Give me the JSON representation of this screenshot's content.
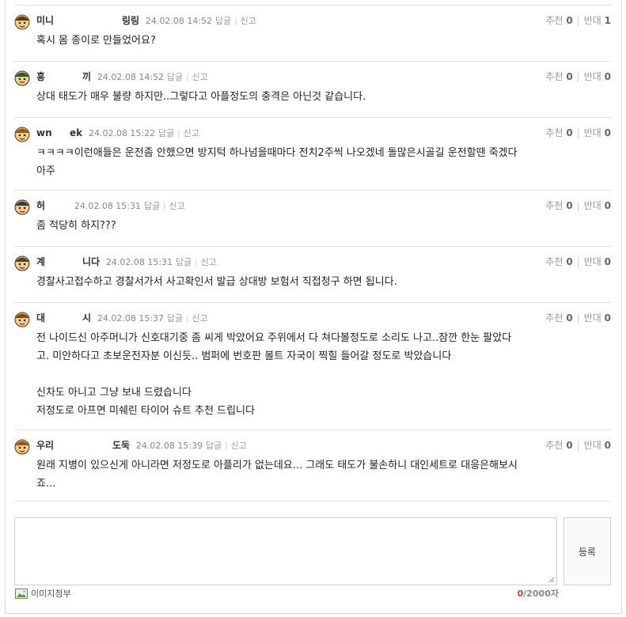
{
  "comments": [
    {
      "nick": "미니",
      "nick2": "링링",
      "date": "24.02.08 14:52",
      "reply": "답글",
      "report": "신고",
      "rec_label": "추천",
      "rec": "0",
      "opp_label": "반대",
      "opp": "1",
      "body": "혹시 몸 종이로 만들었어요?"
    },
    {
      "nick": "흥",
      "nick2": "끼",
      "date": "24.02.08 14:52",
      "reply": "답글",
      "report": "신고",
      "rec_label": "추천",
      "rec": "0",
      "opp_label": "반대",
      "opp": "0",
      "body": "상대 태도가 매우 불량 하지만..그렇다고 아플정도의 충격은 아닌것 같습니다."
    },
    {
      "nick": "wn",
      "nick2": "ek",
      "date": "24.02.08 15:22",
      "reply": "답글",
      "report": "신고",
      "rec_label": "추천",
      "rec": "0",
      "opp_label": "반대",
      "opp": "0",
      "body": "ㅋㅋㅋㅋ이런애들은 운전좀 안했으면 방지턱 하나넘을때마다 전치2주씩 나오겠네 돌많은시골길 운전할땐 죽겠다\n아주"
    },
    {
      "nick": "허",
      "nick2": "",
      "date": "24.02.08 15:31",
      "reply": "답글",
      "report": "신고",
      "rec_label": "추천",
      "rec": "0",
      "opp_label": "반대",
      "opp": "0",
      "body": "좀 적당히 하지???"
    },
    {
      "nick": "계",
      "nick2": "니다",
      "date": "24.02.08 15:31",
      "reply": "답글",
      "report": "신고",
      "rec_label": "추천",
      "rec": "0",
      "opp_label": "반대",
      "opp": "0",
      "body": "경찰사고접수하고 경찰서가서 사고확인서 발급 상대방 보험서 직접청구 하면 됩니다."
    },
    {
      "nick": "대",
      "nick2": "시",
      "date": "24.02.08 15:37",
      "reply": "답글",
      "report": "신고",
      "rec_label": "추천",
      "rec": "0",
      "opp_label": "반대",
      "opp": "0",
      "body": "전 나이드신 아주머니가 신호대기중 좀 씨게 박았어요 주위에서 다 쳐다볼정도로 소리도 나고..잠깐 한눈 팔았다\n고. 미안하다고 초보운전자분 이신듯.. 범퍼에 번호판 볼트 자국이 찍힐 들어갈 정도로 박았습니다\n\n신차도 아니고 그냥 보내 드렸습니다\n저정도로 아프면 미쉐린 타이어 슈트 추천 드립니다"
    },
    {
      "nick": "우리",
      "nick2": "도둑",
      "date": "24.02.08 15:39",
      "reply": "답글",
      "report": "신고",
      "rec_label": "추천",
      "rec": "0",
      "opp_label": "반대",
      "opp": "0",
      "body": "원래 지병이 있으신게 아니라면 저정도로 아플리가 없는데요... 그래도 태도가 불손하니 대인세트로 대응은해보시\n죠..."
    }
  ],
  "composer": {
    "placeholder": "",
    "submit": "등록",
    "attach": "이미지첨부",
    "count": "0",
    "max": "/2000자"
  },
  "icons": {
    "avatar": "character-avatar-icon",
    "attach": "image-attach-icon",
    "resize": "resize-grip-icon"
  }
}
